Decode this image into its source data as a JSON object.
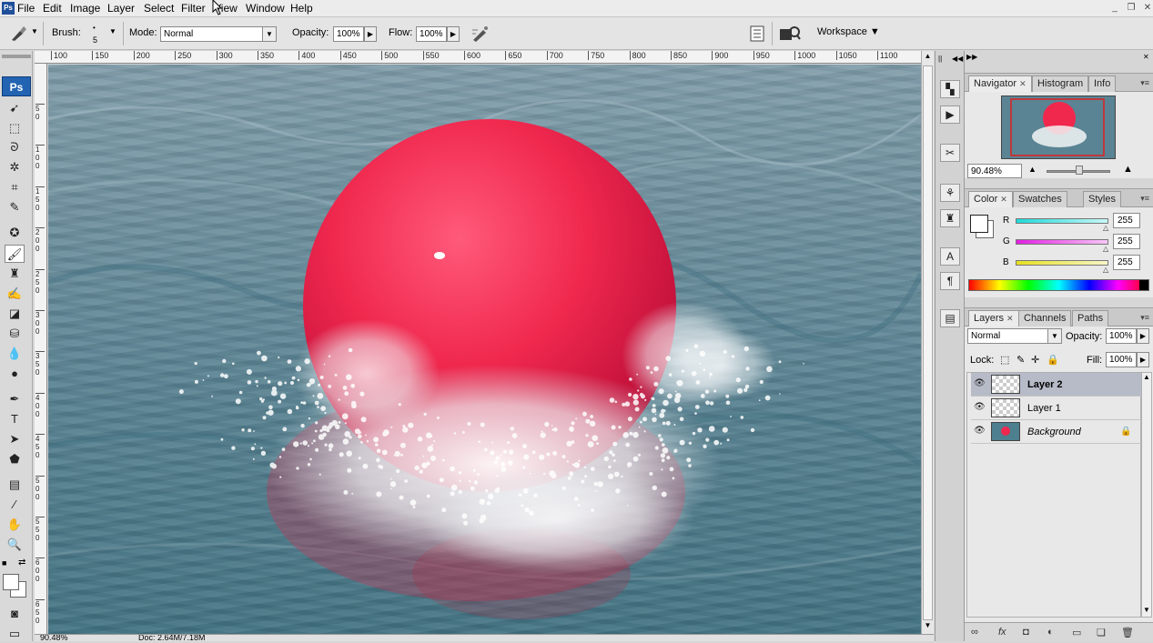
{
  "app": {
    "logo": "Ps"
  },
  "menu": [
    "File",
    "Edit",
    "Image",
    "Layer",
    "Select",
    "Filter",
    "View",
    "Window",
    "Help"
  ],
  "window_controls": [
    "_",
    "❐",
    "✕"
  ],
  "options": {
    "brush_label": "Brush:",
    "brush_size": "5",
    "mode_label": "Mode:",
    "mode_value": "Normal",
    "opacity_label": "Opacity:",
    "opacity_value": "100%",
    "flow_label": "Flow:",
    "flow_value": "100%",
    "workspace_label": "Workspace ▼"
  },
  "ruler_top": [
    "100",
    "150",
    "200",
    "250",
    "300",
    "350",
    "400",
    "450",
    "500",
    "550",
    "600",
    "650",
    "700",
    "750",
    "800",
    "850",
    "900",
    "950",
    "1000",
    "1050",
    "1100"
  ],
  "ruler_left": [
    "5 0",
    "1 0 0",
    "1 5 0",
    "2 0 0",
    "2 5 0",
    "3 0 0",
    "3 5 0",
    "4 0 0",
    "4 5 0",
    "5 0 0",
    "5 5 0",
    "6 0 0",
    "6 5 0"
  ],
  "status": {
    "zoom": "90.48%",
    "doc": "Doc: 2.64M/7.18M"
  },
  "colors": {
    "ball": "#f0284e",
    "water": "#5a8494",
    "selection": "#b7bbc8",
    "ps_blue": "#2264b2"
  },
  "navigator": {
    "tabs": [
      "Navigator",
      "Histogram",
      "Info"
    ],
    "zoom": "90.48%"
  },
  "color_panel": {
    "tabs": [
      "Color",
      "Swatches",
      "Styles"
    ],
    "channels": [
      {
        "label": "R",
        "value": "255",
        "color": "#20d8d8"
      },
      {
        "label": "G",
        "value": "255",
        "color": "#e020e0"
      },
      {
        "label": "B",
        "value": "255",
        "color": "#e6e020"
      }
    ]
  },
  "layers_panel": {
    "tabs": [
      "Layers",
      "Channels",
      "Paths"
    ],
    "blend_mode": "Normal",
    "opacity_label": "Opacity:",
    "opacity_value": "100%",
    "lock_label": "Lock:",
    "fill_label": "Fill:",
    "fill_value": "100%",
    "layers": [
      {
        "name": "Layer 2",
        "selected": true,
        "thumb": "transparent"
      },
      {
        "name": "Layer 1",
        "selected": false,
        "thumb": "transparent"
      },
      {
        "name": "Background",
        "selected": false,
        "thumb": "image",
        "locked": true
      }
    ]
  }
}
